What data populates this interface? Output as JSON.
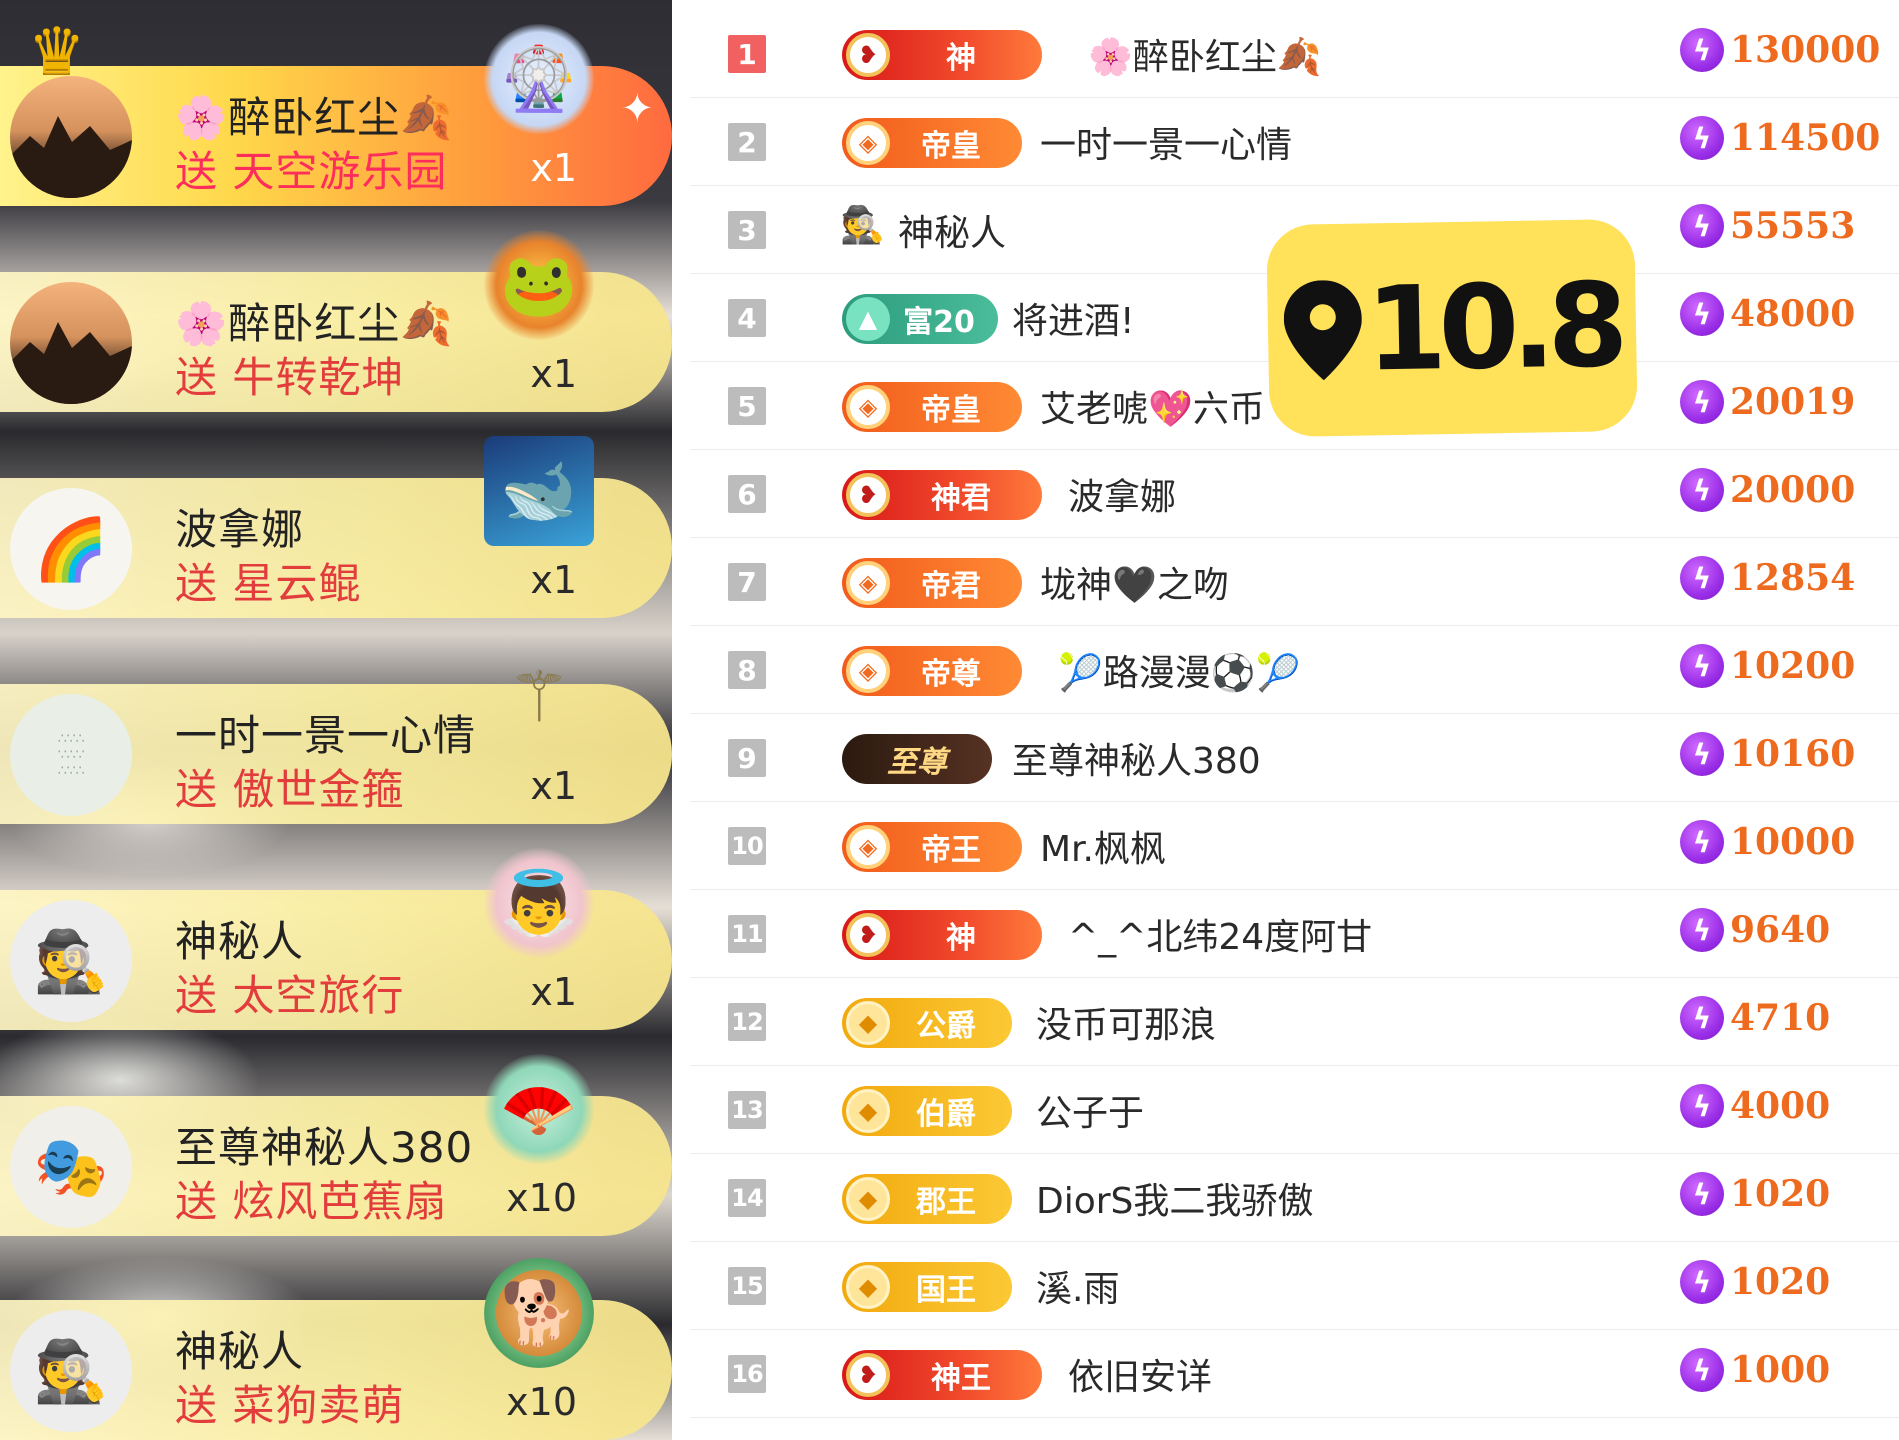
{
  "gifts": [
    {
      "user": "🌸醉卧红尘🍂",
      "gift": "送 天空游乐园",
      "qty": "x1",
      "avatar_icon": "sunset-mountain-avatar",
      "gift_icon": "sky-park-gift-icon"
    },
    {
      "user": "🌸醉卧红尘🍂",
      "gift": "送 牛转乾坤",
      "qty": "x1",
      "avatar_icon": "sunset-mountain-avatar",
      "gift_icon": "golden-toad-gift-icon"
    },
    {
      "user": "波拿娜",
      "gift": "送 星云鲲",
      "qty": "x1",
      "avatar_icon": "rainbow-avatar",
      "gift_icon": "nebula-whale-gift-icon"
    },
    {
      "user": "一时一景一心情",
      "gift": "送 傲世金箍",
      "qty": "x1",
      "avatar_icon": "poem-avatar",
      "gift_icon": "golden-staff-gift-icon"
    },
    {
      "user": "神秘人",
      "gift": "送 太空旅行",
      "qty": "x1",
      "avatar_icon": "mystery-man-avatar",
      "gift_icon": "space-travel-gift-icon"
    },
    {
      "user": "至尊神秘人380",
      "gift": "送 炫风芭蕉扇",
      "qty": "x10",
      "avatar_icon": "mask-avatar",
      "gift_icon": "banana-fan-gift-icon"
    },
    {
      "user": "神秘人",
      "gift": "送 菜狗卖萌",
      "qty": "x10",
      "avatar_icon": "mystery-man-avatar",
      "gift_icon": "shiba-dog-gift-icon"
    }
  ],
  "ranking": [
    {
      "rank": "1",
      "badge": "神",
      "badge_type": "god",
      "name": "🌸醉卧红尘🍂",
      "score": "130000"
    },
    {
      "rank": "2",
      "badge": "帝皇",
      "badge_type": "emperor",
      "name": "一时一景一心情",
      "score": "114500"
    },
    {
      "rank": "3",
      "badge": "",
      "badge_type": "none",
      "name": "神秘人",
      "score": "55553"
    },
    {
      "rank": "4",
      "badge": "富20",
      "badge_type": "rich",
      "name": "将进酒!",
      "score": "48000"
    },
    {
      "rank": "5",
      "badge": "帝皇",
      "badge_type": "emperor",
      "name": "艾老唬💖六币",
      "score": "20019"
    },
    {
      "rank": "6",
      "badge": "神君",
      "badge_type": "god",
      "name": "波拿娜",
      "score": "20000"
    },
    {
      "rank": "7",
      "badge": "帝君",
      "badge_type": "emperor",
      "name": "垅神🖤之吻",
      "score": "12854"
    },
    {
      "rank": "8",
      "badge": "帝尊",
      "badge_type": "emperor",
      "name": "🎾路漫漫⚽🎾",
      "score": "10200"
    },
    {
      "rank": "9",
      "badge": "至尊",
      "badge_type": "supreme",
      "name": "至尊神秘人380",
      "score": "10160"
    },
    {
      "rank": "10",
      "badge": "帝王",
      "badge_type": "emperor",
      "name": "Mr.枫枫",
      "score": "10000"
    },
    {
      "rank": "11",
      "badge": "神",
      "badge_type": "god",
      "name": "^_^北纬24度阿甘",
      "score": "9640"
    },
    {
      "rank": "12",
      "badge": "公爵",
      "badge_type": "noble",
      "name": "没币可那浪",
      "score": "4710"
    },
    {
      "rank": "13",
      "badge": "伯爵",
      "badge_type": "noble",
      "name": "公子于",
      "score": "4000"
    },
    {
      "rank": "14",
      "badge": "郡王",
      "badge_type": "noble",
      "name": "DiorS我二我骄傲",
      "score": "1020"
    },
    {
      "rank": "15",
      "badge": "国王",
      "badge_type": "noble",
      "name": "溪.雨",
      "score": "1020"
    },
    {
      "rank": "16",
      "badge": "神王",
      "badge_type": "god",
      "name": "依旧安详",
      "score": "1000"
    }
  ],
  "watermark": {
    "text": "10.8",
    "icon": "location-pin-icon"
  },
  "colors": {
    "score": "#ee6a1f",
    "rank1": "#f26161",
    "watermark_bg": "#ffe25a",
    "gift_text": "#e23c3c"
  }
}
